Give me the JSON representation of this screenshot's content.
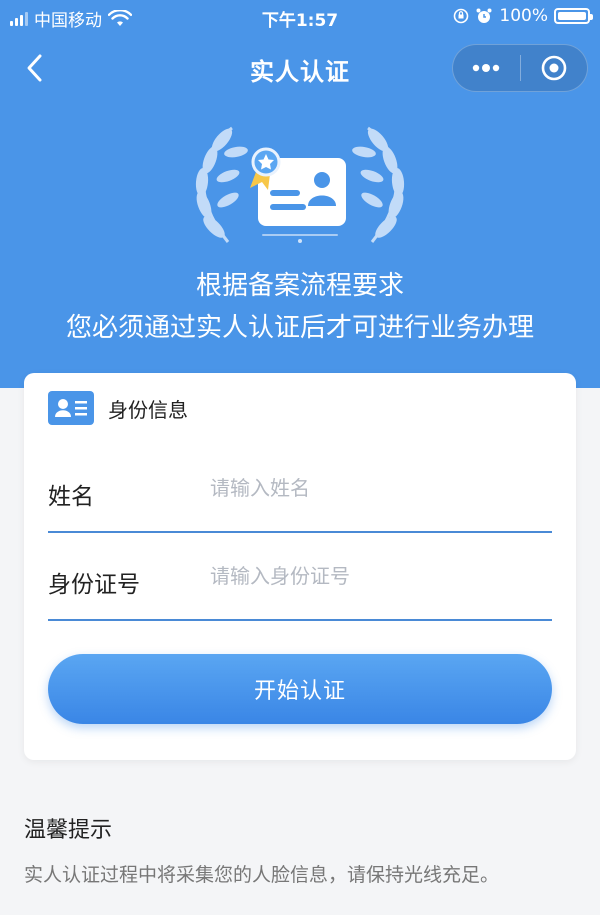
{
  "status_bar": {
    "carrier": "中国移动",
    "time": "下午1:57",
    "battery": "100%"
  },
  "nav": {
    "title": "实人认证"
  },
  "hero": {
    "line1": "根据备案流程要求",
    "line2": "您必须通过实人认证后才可进行业务办理"
  },
  "card": {
    "section_title": "身份信息",
    "name_label": "姓名",
    "name_placeholder": "请输入姓名",
    "name_value": "",
    "id_label": "身份证号",
    "id_placeholder": "请输入身份证号",
    "id_value": "",
    "start_button": "开始认证"
  },
  "tips": {
    "title": "温馨提示",
    "text": "实人认证过程中将采集您的人脸信息，请保持光线充足。"
  },
  "colors": {
    "primary": "#4a95e8",
    "background": "#f4f5f7"
  }
}
